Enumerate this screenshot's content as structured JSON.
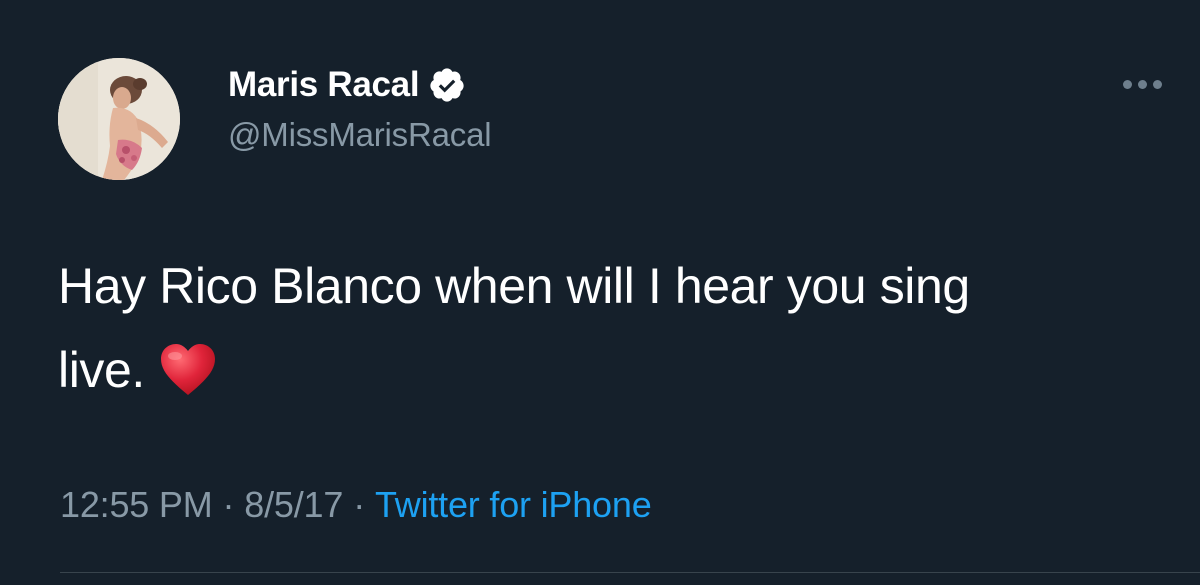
{
  "tweet": {
    "author": {
      "display_name": "Maris Racal",
      "handle": "@MissMarisRacal",
      "verified": true,
      "avatar_icon": "profile-photo"
    },
    "text_line1": "Hay Rico Blanco when will I hear you sing",
    "text_line2": "live.",
    "emoji": "red-heart-icon",
    "time": "12:55 PM",
    "date": "8/5/17",
    "separator": "·",
    "source": "Twitter for iPhone"
  },
  "colors": {
    "background": "#15202b",
    "text": "#ffffff",
    "secondary": "#8899a6",
    "link": "#1da1f2",
    "heart": "#e0243a",
    "divider": "#38444d"
  }
}
